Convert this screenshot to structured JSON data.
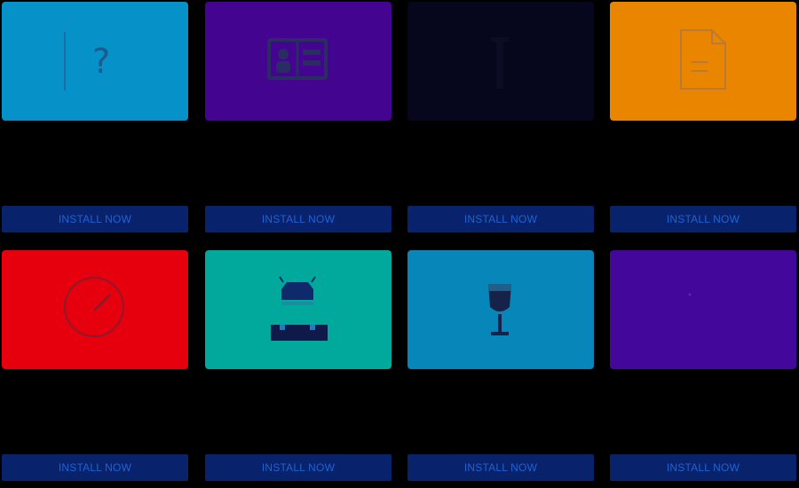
{
  "colors": {
    "button_bg": "#08226b",
    "button_text": "#1f63d6",
    "icon_stroke": "#1b2f66"
  },
  "cards": [
    {
      "icon": "question-mark-icon",
      "tile_color": "#0691c8",
      "button_label": "INSTALL NOW"
    },
    {
      "icon": "contact-card-icon",
      "tile_color": "#43048f",
      "button_label": "INSTALL NOW"
    },
    {
      "icon": "tower-icon",
      "tile_color": "#06061c",
      "button_label": "INSTALL NOW"
    },
    {
      "icon": "document-icon",
      "tile_color": "#ea8500",
      "button_label": "INSTALL NOW"
    },
    {
      "icon": "speedometer-icon",
      "tile_color": "#e6000d",
      "button_label": "INSTALL NOW"
    },
    {
      "icon": "android-robot-icon",
      "tile_color": "#00a99b",
      "button_label": "INSTALL NOW"
    },
    {
      "icon": "wine-glass-icon",
      "tile_color": "#0787b9",
      "button_label": "INSTALL NOW"
    },
    {
      "icon": "faint-symbol-icon",
      "tile_color": "#44079c",
      "button_label": "INSTALL NOW"
    }
  ]
}
